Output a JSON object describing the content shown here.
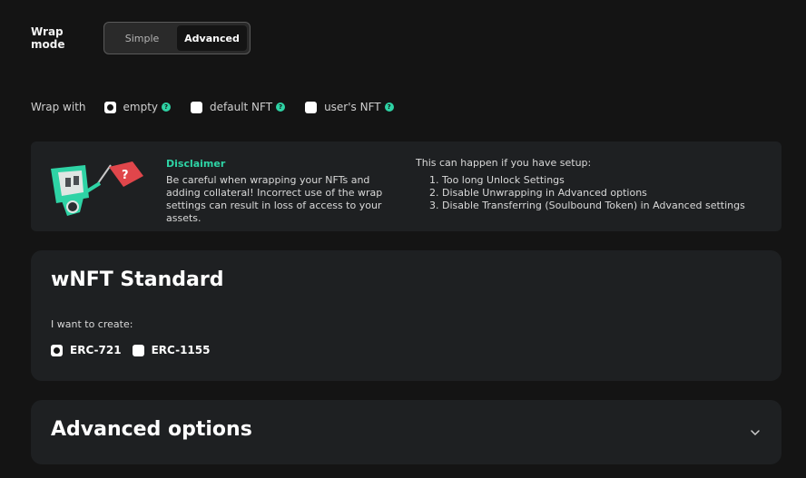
{
  "wrap_mode": {
    "label": "Wrap mode",
    "options": [
      {
        "label": "Simple",
        "active": false
      },
      {
        "label": "Advanced",
        "active": true
      }
    ]
  },
  "wrap_with": {
    "label": "Wrap with",
    "options": [
      {
        "label": "empty",
        "selected": true
      },
      {
        "label": "default NFT",
        "selected": false
      },
      {
        "label": "user's NFT",
        "selected": false
      }
    ],
    "help_glyph": "?"
  },
  "disclaimer": {
    "title": "Disclaimer",
    "text": "Be careful when wrapping your NFTs and adding collateral! Incorrect use of the wrap settings can result in loss of access to your assets.",
    "intro": "This can happen if you have setup:",
    "items": [
      "1. Too long Unlock Settings",
      "2. Disable Unwrapping in Advanced options",
      "3. Disable Transferring (Soulbound Token) in Advanced settings"
    ],
    "flag_glyph": "?"
  },
  "standard": {
    "title": "wNFT Standard",
    "subtitle": "I want to create:",
    "options": [
      {
        "label": "ERC-721",
        "selected": true
      },
      {
        "label": "ERC-1155",
        "selected": false
      }
    ]
  },
  "advanced": {
    "title": "Advanced options",
    "icon": "chevron-down-icon"
  },
  "colors": {
    "background": "#141414",
    "card": "#1e2022",
    "accent": "#2ed3a5",
    "flag": "#e0464b"
  }
}
